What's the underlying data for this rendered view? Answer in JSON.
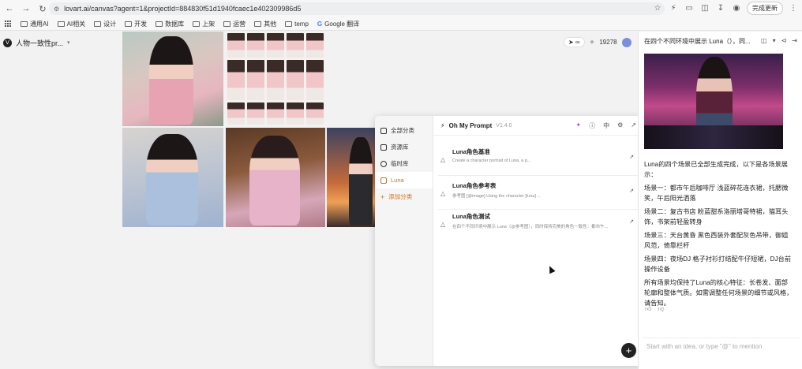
{
  "browser": {
    "url": "lovart.ai/canvas?agent=1&projectId=884830f51d1940fcaec1e402309986d5",
    "update_label": "完成更新"
  },
  "bookmarks": [
    {
      "label": "通用AI"
    },
    {
      "label": "AI相关"
    },
    {
      "label": "设计"
    },
    {
      "label": "开发"
    },
    {
      "label": "数据库"
    },
    {
      "label": "上架"
    },
    {
      "label": "运营"
    },
    {
      "label": "其他"
    },
    {
      "label": "temp"
    },
    {
      "label": "Google 翻译"
    }
  ],
  "canvas": {
    "project_title": "人物一致性pr...",
    "credits": "19278"
  },
  "prompt_panel": {
    "title": "Oh My Prompt",
    "version": "V1.4.0",
    "lang_icon_label": "中",
    "sidebar": [
      {
        "label": "全部分类",
        "active": false
      },
      {
        "label": "资源库",
        "active": false
      },
      {
        "label": "临时库",
        "active": false
      },
      {
        "label": "Luna",
        "active": true
      },
      {
        "label": "添加分类",
        "active": false
      }
    ],
    "cards": [
      {
        "title": "Luna角色基准",
        "desc": "Create a character portrait of Luna, a p..."
      },
      {
        "title": "Luna角色参考表",
        "desc": "参考图 [@image] Using the character [luna] ..."
      },
      {
        "title": "Luna角色测试",
        "desc": "在四个不同环境中展示 Luna（@参考图），同时保持完美的角色一致性：都市午..."
      }
    ],
    "fab_label": "+"
  },
  "chat": {
    "title": "在四个不同环境中展示 Luna（），同...",
    "intro": "Luna的四个场景已全部生成完成，以下是各场景展示：",
    "scenes": [
      "场景一：都市午后咖啡厅 浅蓝碎花连衣裙，托腮微笑，午后阳光洒落",
      "场景二：复古书店 粉蓝甜系洛丽塔哥特裙，猫耳头饰，书架前轻盈转身",
      "场景三：天台黄昏 黑色西装外套配灰色吊带，御姐风范，倚靠栏杆",
      "场景四：夜场DJ 格子衬衫打结配牛仔短裙，DJ台前操作设备"
    ],
    "summary": "所有场景均保持了Luna的核心特征：长卷发、面部轮廓和整体气质。如需调整任何场景的细节或风格，请告知。",
    "composer_placeholder": "Start with an idea, or type \"@\" to mention"
  }
}
